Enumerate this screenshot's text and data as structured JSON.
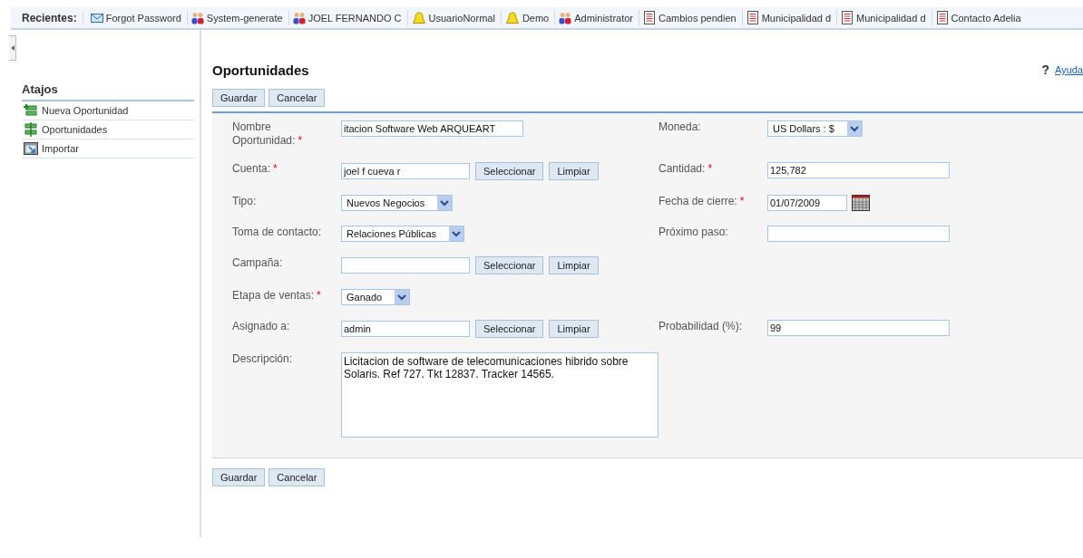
{
  "recents": {
    "label": "Recientes:",
    "items": [
      {
        "kind": "mail",
        "label": "Forgot Password"
      },
      {
        "kind": "users",
        "label": "System-generate"
      },
      {
        "kind": "users",
        "label": "JOEL FERNANDO C"
      },
      {
        "kind": "bell",
        "label": "UsuarioNormal"
      },
      {
        "kind": "bell",
        "label": "Demo"
      },
      {
        "kind": "users",
        "label": "Administrator"
      },
      {
        "kind": "doc",
        "label": "Cambios pendien"
      },
      {
        "kind": "doc",
        "label": "Municipalidad d"
      },
      {
        "kind": "doc",
        "label": "Municipalidad d"
      },
      {
        "kind": "doc",
        "label": "Contacto Adelia"
      }
    ]
  },
  "sidebar": {
    "title": "Atajos",
    "items": [
      {
        "kind": "new",
        "label": "Nueva Oportunidad"
      },
      {
        "kind": "money",
        "label": "Oportunidades"
      },
      {
        "kind": "import",
        "label": "Importar"
      }
    ]
  },
  "page": {
    "title": "Oportunidades",
    "help_mark": "?",
    "help_link": "Ayuda"
  },
  "buttons_top": [
    "Guardar",
    "Cancelar"
  ],
  "rows": [
    {
      "left": {
        "kind": "text",
        "label": "Nombre Oportunidad:",
        "required_mark": "*",
        "value": "itacion Software Web ARQUEART"
      },
      "right": {
        "kind": "select",
        "label": "Moneda:",
        "value": "US Dollars : $"
      }
    },
    {
      "left": {
        "kind": "lookup",
        "label": "Cuenta:",
        "required_mark": "*",
        "value": "joel f cueva r",
        "buttons": [
          "Seleccionar",
          "Limpiar"
        ]
      },
      "right": {
        "kind": "text",
        "label": "Cantidad:",
        "required_mark": "*",
        "value": "125,782"
      }
    },
    {
      "left": {
        "kind": "select",
        "label": "Tipo:",
        "value": "Nuevos Negocios"
      },
      "right": {
        "kind": "date",
        "label": "Fecha de cierre:",
        "required_mark": "*",
        "value": "01/07/2009"
      }
    },
    {
      "left": {
        "kind": "select",
        "label": "Toma de contacto:",
        "value": "Relaciones Públicas"
      },
      "right": {
        "kind": "text",
        "label": "Próximo paso:"
      }
    },
    {
      "left": {
        "kind": "lookup",
        "label": "Campaña:",
        "buttons": [
          "Seleccionar",
          "Limpiar"
        ]
      }
    },
    {
      "left": {
        "kind": "select",
        "label": "Etapa de ventas:",
        "required_mark": "*",
        "value": "Ganado"
      }
    },
    {
      "left": {
        "kind": "lookup",
        "label": "Asignado a:",
        "value": "admin",
        "buttons": [
          "Seleccionar",
          "Limpiar"
        ]
      },
      "right": {
        "kind": "text",
        "label": "Probabilidad (%):",
        "value": "99"
      }
    },
    {
      "left": {
        "kind": "textarea",
        "label": "Descripción:",
        "value": "Licitacion de software de telecomunicaciones hibrido sobre Solaris. Ref 727. Tkt 12837. Tracker 14565."
      }
    }
  ],
  "buttons_bottom": [
    "Guardar",
    "Cancelar"
  ]
}
